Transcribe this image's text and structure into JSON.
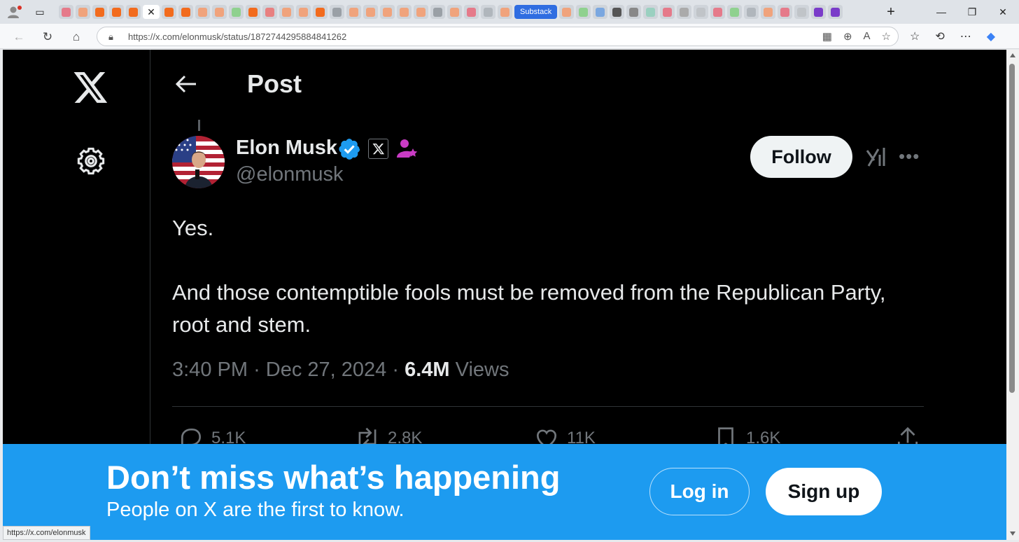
{
  "browser": {
    "url": "https://x.com/elonmusk/status/1872744295884841262",
    "substack_tab_label": "Substack",
    "status_url": "https://x.com/elonmusk"
  },
  "header": {
    "title": "Post"
  },
  "post": {
    "author_name": "Elon Musk",
    "author_handle": "@elonmusk",
    "follow_label": "Follow",
    "text_line1": "Yes.",
    "text_line2": "And those contemptible fools must be removed from the Republican Party, root and stem.",
    "time": "3:40 PM",
    "date": "Dec 27, 2024",
    "views_count": "6.4M",
    "views_label": "Views",
    "separator": "·"
  },
  "actions": {
    "replies": "5.1K",
    "reposts": "2.8K",
    "likes": "11K",
    "bookmarks": "1.6K"
  },
  "banner": {
    "title": "Don’t miss what’s happening",
    "subtitle": "People on X are the first to know.",
    "login_label": "Log in",
    "signup_label": "Sign up"
  },
  "colors": {
    "accent": "#1d9bf0",
    "background": "#000000",
    "text_primary": "#e7e9ea",
    "text_secondary": "#71767b",
    "verified": "#1d9bf0",
    "affiliate_badge": "#c93bc4"
  },
  "icons": {
    "logo": "x-logo-icon",
    "settings": "gear-icon",
    "back": "back-arrow-icon",
    "verified": "verified-badge-icon",
    "affiliation": "x-affiliation-icon",
    "subscriber": "person-star-icon",
    "grok": "grok-icon",
    "more": "more-icon",
    "reply": "reply-icon",
    "repost": "repost-icon",
    "like": "heart-icon",
    "bookmark": "bookmark-icon",
    "share": "share-icon"
  }
}
